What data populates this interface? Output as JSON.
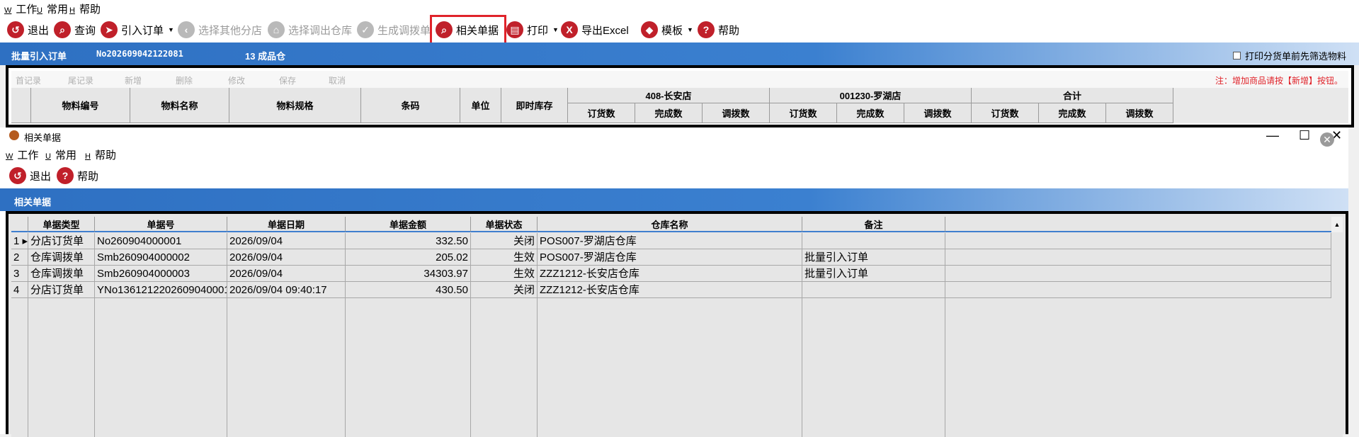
{
  "main": {
    "menu": [
      {
        "key": "W",
        "label": "工作"
      },
      {
        "key": "U",
        "label": "常用"
      },
      {
        "key": "H",
        "label": "帮助"
      }
    ],
    "toolbar": {
      "exit": "退出",
      "query": "查询",
      "import_order": "引入订单",
      "select_other_store": "选择其他分店",
      "select_out_warehouse": "选择调出仓库",
      "generate_transfer": "生成调拨单",
      "related_docs": "相关单据",
      "print": "打印",
      "export_excel": "导出Excel",
      "template": "模板",
      "help": "帮助"
    },
    "banner": {
      "title": "批量引入订单",
      "doc_no": "No202609042122081",
      "info": "13  成品仓",
      "checkbox_label": "打印分货单前先筛选物料"
    },
    "grid_toolbar": {
      "first": "首记录",
      "last": "尾记录",
      "add": "新增",
      "delete": "删除",
      "modify": "修改",
      "save": "保存",
      "cancel": "取消",
      "note": "注：增加商品请按【新增】按钮。"
    },
    "grid_headers": {
      "item_code": "物料编号",
      "item_name": "物料名称",
      "item_spec": "物料规格",
      "barcode": "条码",
      "unit": "单位",
      "stock": "即时库存",
      "store1": "408-长安店",
      "store2": "001230-罗湖店",
      "total": "合计",
      "order_qty": "订货数",
      "done_qty": "完成数",
      "transfer_qty": "调拨数"
    }
  },
  "child": {
    "title": "相关单据",
    "win_minimize": "—",
    "win_maximize": "☐",
    "win_close": "✕",
    "menu": [
      {
        "key": "W",
        "label": "工作"
      },
      {
        "key": "U",
        "label": "常用"
      },
      {
        "key": "H",
        "label": "帮助"
      }
    ],
    "toolbar": {
      "exit": "退出",
      "help": "帮助"
    },
    "banner_title": "相关单据",
    "columns": [
      "单据类型",
      "单据号",
      "单据日期",
      "单据金额",
      "单据状态",
      "仓库名称",
      "备注"
    ],
    "rows": [
      {
        "idx": "1",
        "type": "分店订货单",
        "no": "No260904000001",
        "date": "2026/09/04",
        "amount": "332.50",
        "status": "关闭",
        "warehouse": "POS007-罗湖店仓库",
        "remark": ""
      },
      {
        "idx": "2",
        "type": "仓库调拨单",
        "no": "Smb260904000002",
        "date": "2026/09/04",
        "amount": "205.02",
        "status": "生效",
        "warehouse": "POS007-罗湖店仓库",
        "remark": "批量引入订单"
      },
      {
        "idx": "3",
        "type": "仓库调拨单",
        "no": "Smb260904000003",
        "date": "2026/09/04",
        "amount": "34303.97",
        "status": "生效",
        "warehouse": "ZZZ1212-长安店仓库",
        "remark": "批量引入订单"
      },
      {
        "idx": "4",
        "type": "分店订货单",
        "no": "YNo1361212202609040001",
        "date": "2026/09/04 09:40:17",
        "amount": "430.50",
        "status": "关闭",
        "warehouse": "ZZZ1212-长安店仓库",
        "remark": ""
      }
    ]
  },
  "colors": {
    "accent_red": "#c0202a",
    "banner_blue": "#2e70c2",
    "highlight": "#e0232a"
  }
}
